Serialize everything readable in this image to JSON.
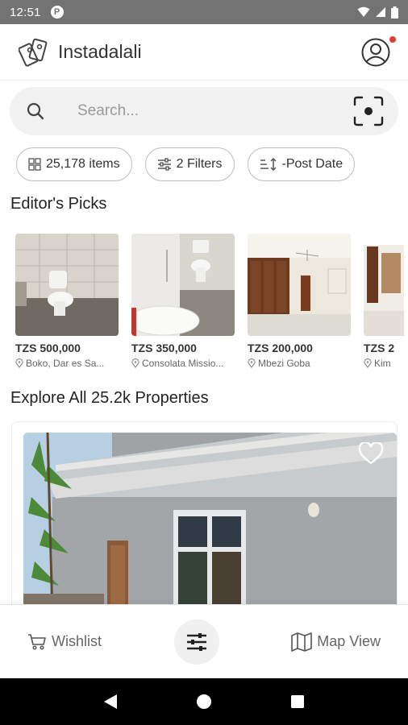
{
  "status_bar": {
    "time": "12:51"
  },
  "app": {
    "title": "Instadalali"
  },
  "search": {
    "placeholder": "Search..."
  },
  "chips": {
    "items_label": "25,178 items",
    "filters_label": "2 Filters",
    "sort_label": "-Post Date"
  },
  "editors_picks": {
    "title": "Editor's Picks",
    "items": [
      {
        "price": "TZS 500,000",
        "location": "Boko,  Dar es Sa..."
      },
      {
        "price": "TZS 350,000",
        "location": "Consolata Missio..."
      },
      {
        "price": "TZS 200,000",
        "location": "Mbezi Goba"
      },
      {
        "price": "TZS 2",
        "location": "Kim"
      }
    ]
  },
  "explore": {
    "title": "Explore All 25.2k Properties"
  },
  "bottom_bar": {
    "wishlist_label": "Wishlist",
    "map_label": "Map View"
  },
  "colors": {
    "accent_dot": "#e53935",
    "status_bar": "#737373"
  }
}
